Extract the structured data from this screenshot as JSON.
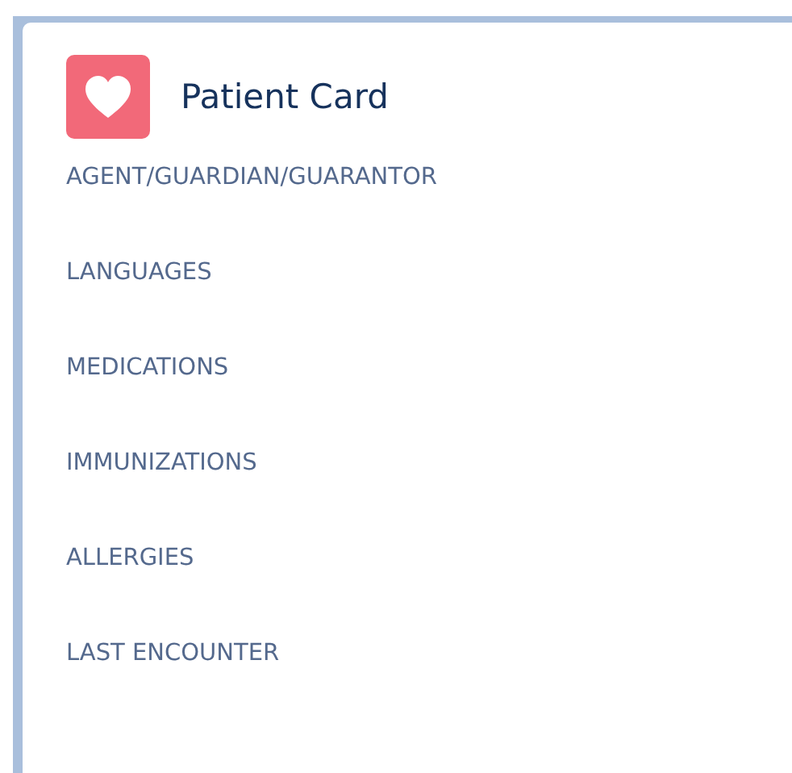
{
  "card": {
    "title": "Patient Card"
  },
  "sections": [
    {
      "label": "AGENT/GUARDIAN/GUARANTOR"
    },
    {
      "label": "LANGUAGES"
    },
    {
      "label": "MEDICATIONS"
    },
    {
      "label": "IMMUNIZATIONS"
    },
    {
      "label": "ALLERGIES"
    },
    {
      "label": "LAST ENCOUNTER"
    }
  ]
}
